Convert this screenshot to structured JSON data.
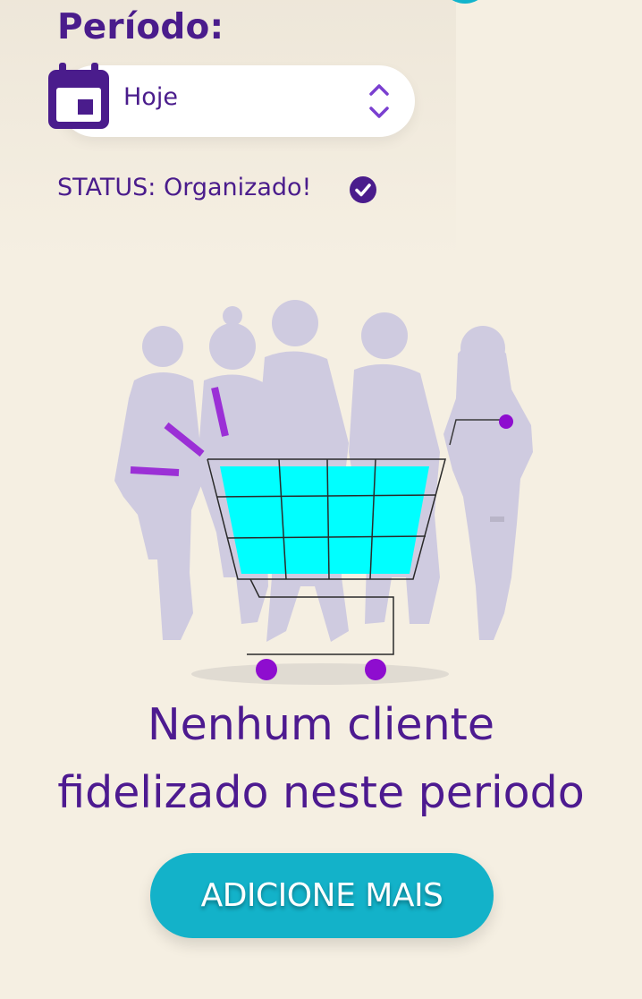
{
  "filter": {
    "label": "Período:",
    "selected": "Hoje",
    "calendar_icon": "calendar-icon",
    "stepper_icon": "chevron-up-down-icon"
  },
  "status": {
    "text": "STATUS: Organizado!",
    "icon": "check-circle-icon"
  },
  "empty_state": {
    "illustration": "shopping-cart-people-illustration",
    "message_line1": "Nenhum cliente",
    "message_line2": "fidelizado neste periodo"
  },
  "cta": {
    "label": "ADICIONE MAIS"
  },
  "colors": {
    "primary": "#4a1c8c",
    "accent": "#13b2c9",
    "background": "#f5efe2",
    "cart_fill": "#00ffff",
    "wheel": "#8e0dcf",
    "silhouettes": "#cfcbe0"
  }
}
